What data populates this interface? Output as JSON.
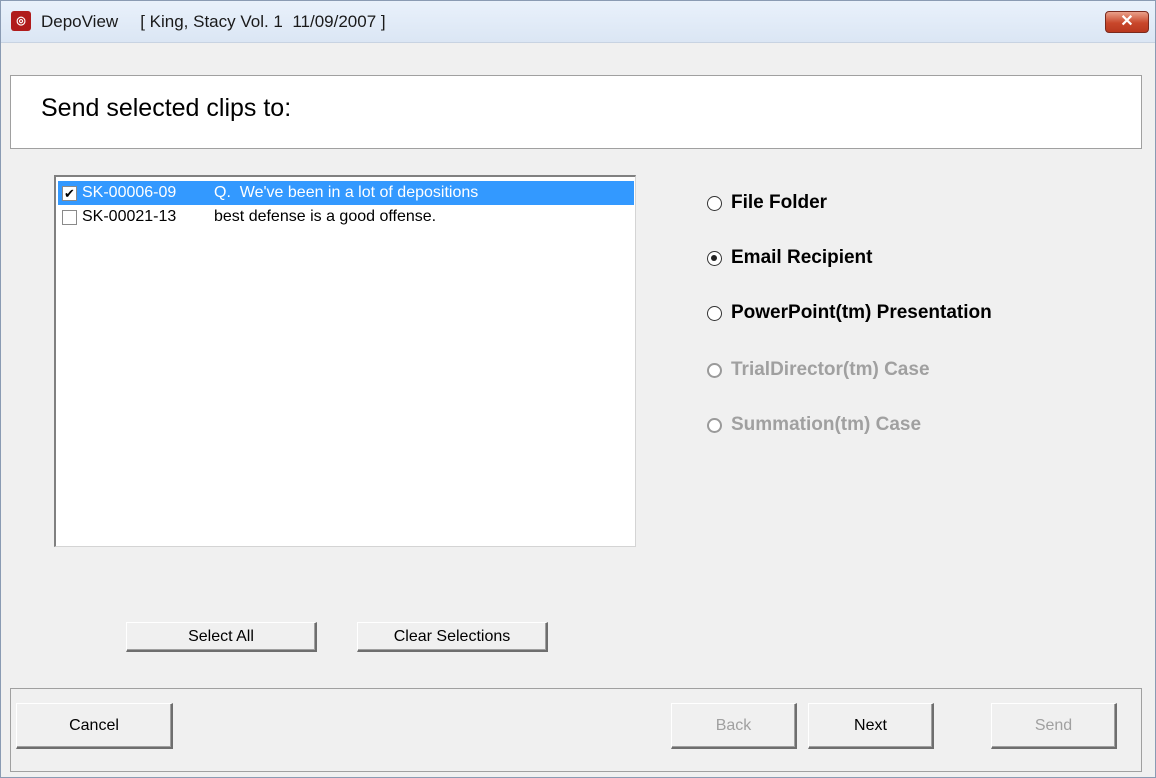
{
  "window": {
    "app_name": "DepoView",
    "case_title": "[ King, Stacy Vol. 1  11/09/2007 ]",
    "close_symbol": "✕"
  },
  "header": {
    "title": "Send selected clips to:"
  },
  "clips": [
    {
      "id": "SK-00006-09",
      "text": "Q.  We've been in a lot of depositions",
      "checked": true,
      "selected": true
    },
    {
      "id": "SK-00021-13",
      "text": "best defense is a good offense.",
      "checked": false,
      "selected": false
    }
  ],
  "destinations": [
    {
      "label": "File Folder",
      "selected": false,
      "enabled": true
    },
    {
      "label": "Email Recipient",
      "selected": true,
      "enabled": true
    },
    {
      "label": "PowerPoint(tm) Presentation",
      "selected": false,
      "enabled": true
    },
    {
      "label": "TrialDirector(tm) Case",
      "selected": false,
      "enabled": false
    },
    {
      "label": "Summation(tm) Case",
      "selected": false,
      "enabled": false
    }
  ],
  "list_buttons": {
    "select_all": "Select All",
    "clear_selections": "Clear Selections"
  },
  "footer_buttons": {
    "cancel": "Cancel",
    "back": "Back",
    "next": "Next",
    "send": "Send"
  },
  "colors": {
    "selection": "#3399ff",
    "disabled_text": "#a0a0a0",
    "app_icon": "#b01c1c"
  }
}
